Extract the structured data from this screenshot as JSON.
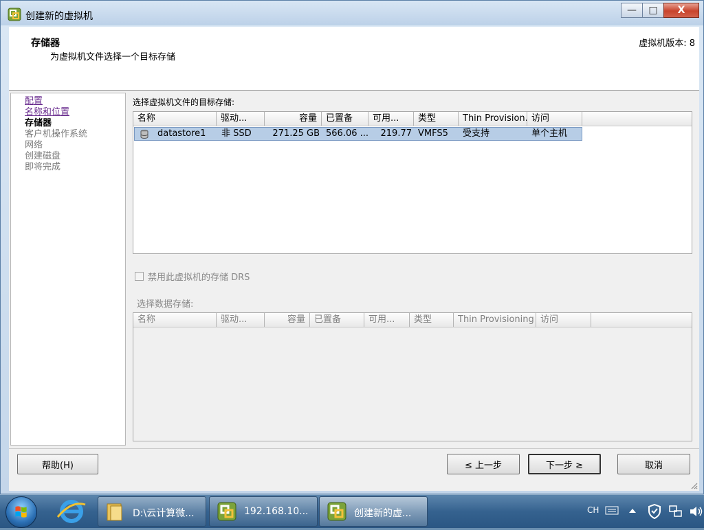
{
  "window": {
    "title": "创建新的虚拟机",
    "controls": {
      "minimize": "—",
      "maximize": "□",
      "close": "X"
    }
  },
  "header": {
    "title": "存储器",
    "subtitle": "为虚拟机文件选择一个目标存储",
    "version": "虚拟机版本: 8"
  },
  "sidebar": {
    "items": [
      {
        "label": "配置",
        "state": "visited"
      },
      {
        "label": "名称和位置",
        "state": "visited"
      },
      {
        "label": "存储器",
        "state": "current"
      },
      {
        "label": "客户机操作系统",
        "state": "future"
      },
      {
        "label": "网络",
        "state": "future"
      },
      {
        "label": "创建磁盘",
        "state": "future"
      },
      {
        "label": "即将完成",
        "state": "future"
      }
    ]
  },
  "main": {
    "select_label": "选择虚拟机文件的目标存储:",
    "columns": [
      "名称",
      "驱动...",
      "容量",
      "已置备",
      "可用...",
      "类型",
      "Thin Provision...",
      "访问"
    ],
    "rows": [
      {
        "name": "datastore1",
        "drive": "非 SSD",
        "capacity": "271.25 GB",
        "provisioned": "566.06 ...",
        "free": "219.77",
        "type": "VMFS5",
        "thin": "受支持",
        "access": "单个主机"
      }
    ],
    "drs_checkbox": "禁用此虚拟机的存储 DRS",
    "select_datastore_label": "选择数据存储:",
    "columns2": [
      "名称",
      "驱动...",
      "容量",
      "已置备",
      "可用...",
      "类型",
      "Thin Provisioning",
      "访问"
    ]
  },
  "buttons": {
    "help": "帮助(H)",
    "back": "≤ 上一步",
    "next": "下一步 ≥",
    "cancel": "取消"
  },
  "taskbar": {
    "items": [
      {
        "label": "D:\\云计算微...",
        "icon": "folder-icon"
      },
      {
        "label": "192.168.10...",
        "icon": "vsphere-icon"
      },
      {
        "label": "创建新的虚...",
        "icon": "vsphere-icon",
        "active": true
      }
    ],
    "tray": {
      "lang": "CH"
    }
  }
}
